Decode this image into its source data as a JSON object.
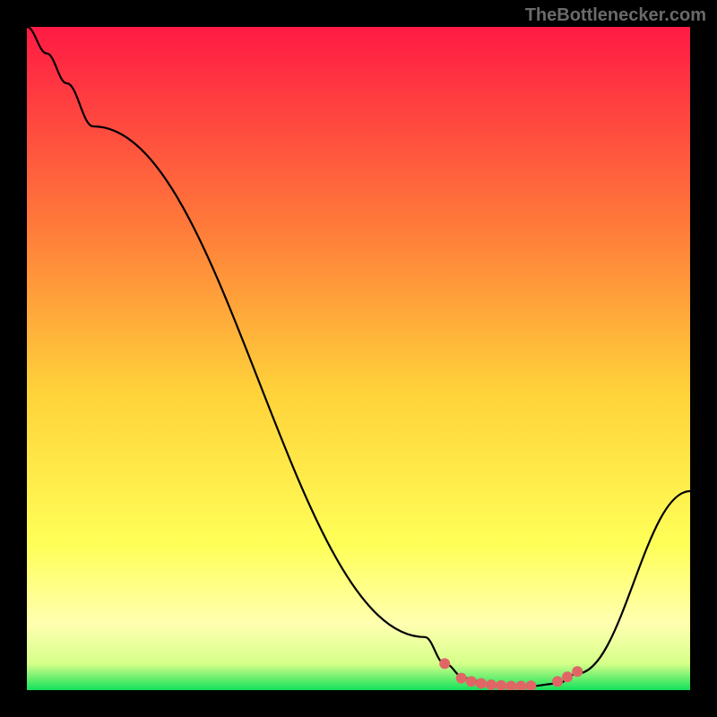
{
  "watermark": "TheBottlenecker.com",
  "chart_data": {
    "type": "line",
    "title": "",
    "xlabel": "",
    "ylabel": "",
    "xlim": [
      0,
      100
    ],
    "ylim": [
      0,
      100
    ],
    "background_gradient": {
      "stops": [
        {
          "offset": 0.0,
          "color": "#ff1a44"
        },
        {
          "offset": 0.3,
          "color": "#ff7a3a"
        },
        {
          "offset": 0.55,
          "color": "#ffd23a"
        },
        {
          "offset": 0.78,
          "color": "#ffff58"
        },
        {
          "offset": 0.9,
          "color": "#ffffb0"
        },
        {
          "offset": 0.96,
          "color": "#d6ff8a"
        },
        {
          "offset": 1.0,
          "color": "#12e25a"
        }
      ]
    },
    "series": [
      {
        "name": "curve",
        "color": "#000000",
        "width": 2.2,
        "points": [
          {
            "x": 0.0,
            "y": 100.0
          },
          {
            "x": 3.0,
            "y": 96.0
          },
          {
            "x": 6.0,
            "y": 91.5
          },
          {
            "x": 10.0,
            "y": 85.0
          },
          {
            "x": 60.0,
            "y": 8.0
          },
          {
            "x": 63.0,
            "y": 4.0
          },
          {
            "x": 66.0,
            "y": 1.8
          },
          {
            "x": 70.0,
            "y": 0.8
          },
          {
            "x": 76.0,
            "y": 0.6
          },
          {
            "x": 80.0,
            "y": 1.0
          },
          {
            "x": 83.0,
            "y": 2.5
          },
          {
            "x": 100.0,
            "y": 30.0
          }
        ]
      },
      {
        "name": "markers",
        "type": "scatter",
        "color": "#e06666",
        "radius": 6,
        "points": [
          {
            "x": 63.0,
            "y": 4.0
          },
          {
            "x": 65.5,
            "y": 1.8
          },
          {
            "x": 67.0,
            "y": 1.3
          },
          {
            "x": 68.5,
            "y": 1.0
          },
          {
            "x": 70.0,
            "y": 0.8
          },
          {
            "x": 71.5,
            "y": 0.7
          },
          {
            "x": 73.0,
            "y": 0.6
          },
          {
            "x": 74.5,
            "y": 0.6
          },
          {
            "x": 76.0,
            "y": 0.65
          },
          {
            "x": 80.0,
            "y": 1.3
          },
          {
            "x": 81.5,
            "y": 2.0
          },
          {
            "x": 83.0,
            "y": 2.8
          }
        ]
      }
    ]
  }
}
